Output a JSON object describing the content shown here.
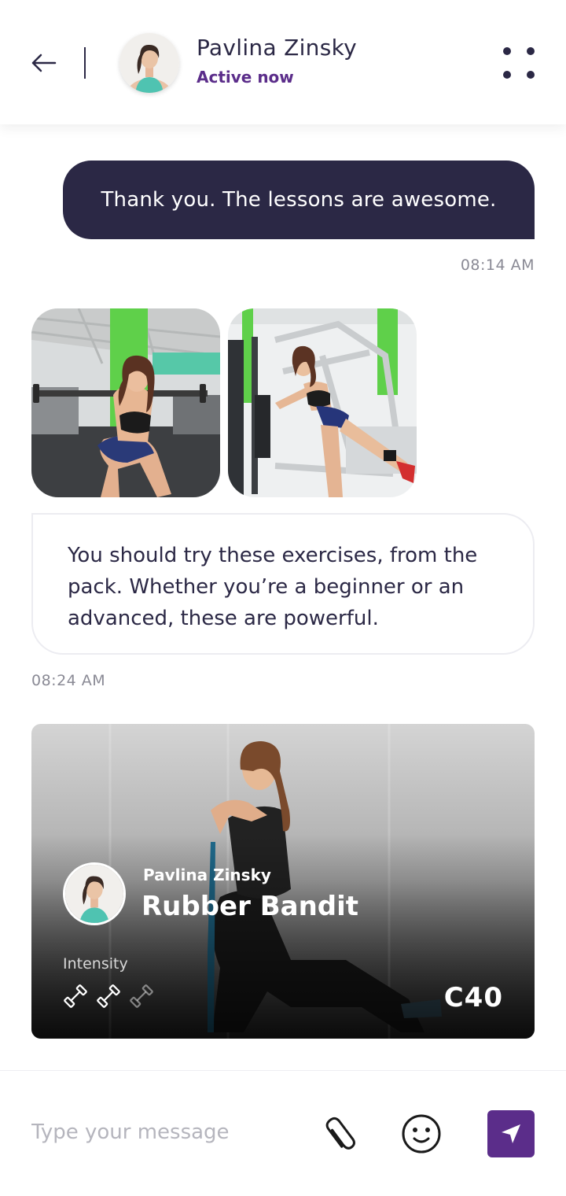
{
  "header": {
    "contact_name": "Pavlina Zinsky",
    "status": "Active now",
    "back_icon": "arrow-left-icon",
    "more_icon": "four-dots-icon"
  },
  "messages": [
    {
      "direction": "outgoing",
      "text": "Thank you. The lessons are awesome.",
      "time": "08:14 AM"
    },
    {
      "direction": "incoming",
      "type": "photos",
      "photos": [
        "barbell-squat-photo",
        "cable-kickback-photo"
      ]
    },
    {
      "direction": "incoming",
      "text": "You should try these exercises, from the pack. Whether you’re a beginner or an advanced, these are powerful.",
      "time": "08:24 AM"
    }
  ],
  "workout_card": {
    "author": "Pavlina Zinsky",
    "title": "Rubber Bandit",
    "intensity_label": "Intensity",
    "intensity_level": 2,
    "intensity_max": 3,
    "code": "C40"
  },
  "composer": {
    "placeholder": "Type your message",
    "attach_icon": "paperclip-icon",
    "emoji_icon": "smiley-icon",
    "send_icon": "send-arrow-icon"
  },
  "colors": {
    "primary_dark": "#2b2845",
    "accent": "#5b2d8a",
    "muted_text": "#8a8a95",
    "gym_green": "#5fd04a"
  }
}
